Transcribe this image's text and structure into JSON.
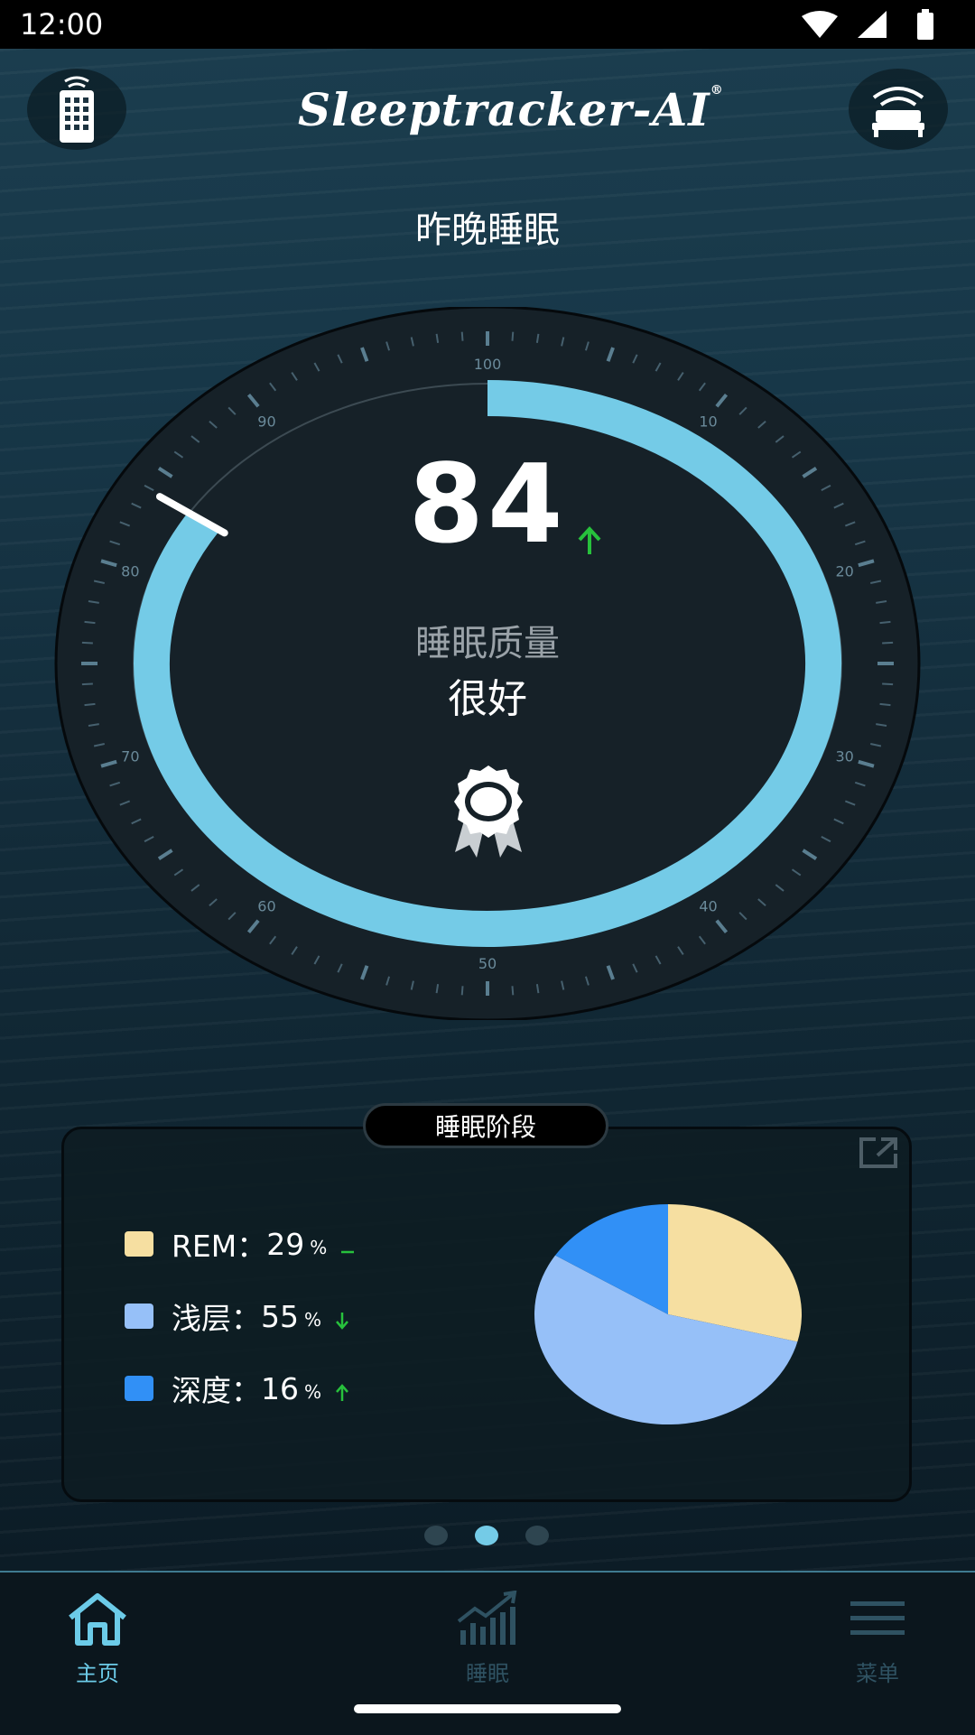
{
  "status_bar": {
    "time": "12:00"
  },
  "header": {
    "logo_main": "Sleeptracker",
    "logo_suffix": "-AI",
    "logo_mark": "®",
    "left_icon": "remote-control-icon",
    "right_icon": "smart-bed-icon"
  },
  "section_title": "昨晚睡眠",
  "gauge": {
    "score": "84",
    "score_trend": "up",
    "score_progress_fraction": 0.84,
    "scale_labels": [
      "100",
      "10",
      "20",
      "30",
      "40",
      "50",
      "60",
      "70",
      "80",
      "90"
    ],
    "quality_label": "睡眠质量",
    "quality_value": "很好",
    "badge_icon": "award-ribbon-icon",
    "colors": {
      "arc": "#74cbe7",
      "face": "#162128",
      "needle": "#ffffff"
    }
  },
  "sleep_stages": {
    "title": "睡眠阶段",
    "expand_icon": "open-external-icon",
    "items": [
      {
        "label": "REM：",
        "value": "29",
        "unit": "%",
        "trend": "flat",
        "color": "#f6dfa1"
      },
      {
        "label": "浅层：",
        "value": "55",
        "unit": "%",
        "trend": "down",
        "color": "#96c0f8"
      },
      {
        "label": "深度：",
        "value": "16",
        "unit": "%",
        "trend": "up",
        "color": "#3190f6"
      }
    ],
    "trend_color": "#27c13c"
  },
  "pager": {
    "count": 3,
    "active_index": 1
  },
  "tab_bar": {
    "tabs": [
      {
        "label": "主页",
        "icon": "home-icon",
        "active": true
      },
      {
        "label": "睡眠",
        "icon": "bar-chart-trend-icon",
        "active": false
      },
      {
        "label": "菜单",
        "icon": "menu-icon",
        "active": false
      }
    ]
  }
}
